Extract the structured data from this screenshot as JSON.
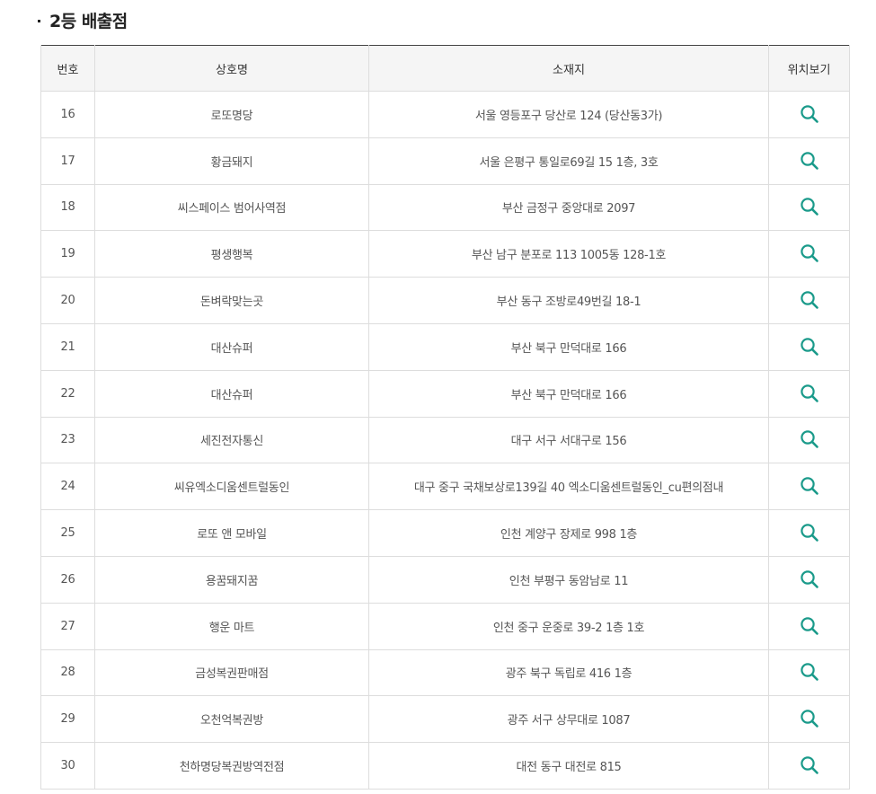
{
  "section": {
    "title": "2등 배출점"
  },
  "table": {
    "headers": {
      "no": "번호",
      "name": "상호명",
      "address": "소재지",
      "map": "위치보기"
    },
    "rows": [
      {
        "no": "16",
        "name": "로또명당",
        "address": "서울 영등포구 당산로 124 (당산동3가)"
      },
      {
        "no": "17",
        "name": "황금돼지",
        "address": "서울 은평구 통일로69길 15 1층, 3호"
      },
      {
        "no": "18",
        "name": "씨스페이스 범어사역점",
        "address": "부산 금정구 중앙대로 2097"
      },
      {
        "no": "19",
        "name": "평생행복",
        "address": "부산 남구 분포로 113 1005동 128-1호"
      },
      {
        "no": "20",
        "name": "돈벼락맞는곳",
        "address": "부산 동구 조방로49번길 18-1"
      },
      {
        "no": "21",
        "name": "대산슈퍼",
        "address": "부산 북구 만덕대로 166"
      },
      {
        "no": "22",
        "name": "대산슈퍼",
        "address": "부산 북구 만덕대로 166"
      },
      {
        "no": "23",
        "name": "세진전자통신",
        "address": "대구 서구 서대구로 156"
      },
      {
        "no": "24",
        "name": "씨유엑소디움센트럴동인",
        "address": "대구 중구 국채보상로139길 40 엑소디움센트럴동인_cu편의점내"
      },
      {
        "no": "25",
        "name": "로또 앤 모바일",
        "address": "인천 계양구 장제로 998 1층"
      },
      {
        "no": "26",
        "name": "용꿈돼지꿈",
        "address": "인천 부평구 동암남로 11"
      },
      {
        "no": "27",
        "name": "행운 마트",
        "address": "인천 중구 운중로 39-2 1층 1호"
      },
      {
        "no": "28",
        "name": "금성복권판매점",
        "address": "광주 북구 독립로 416 1층"
      },
      {
        "no": "29",
        "name": "오천억복권방",
        "address": "광주 서구 상무대로 1087"
      },
      {
        "no": "30",
        "name": "천하명당복권방역전점",
        "address": "대전 동구 대전로 815"
      }
    ]
  },
  "icons": {
    "map": "search-icon"
  },
  "colors": {
    "accent": "#1a9a8a",
    "header_bg": "#f5f5f5",
    "border": "#dddddd",
    "top_border": "#444444"
  }
}
